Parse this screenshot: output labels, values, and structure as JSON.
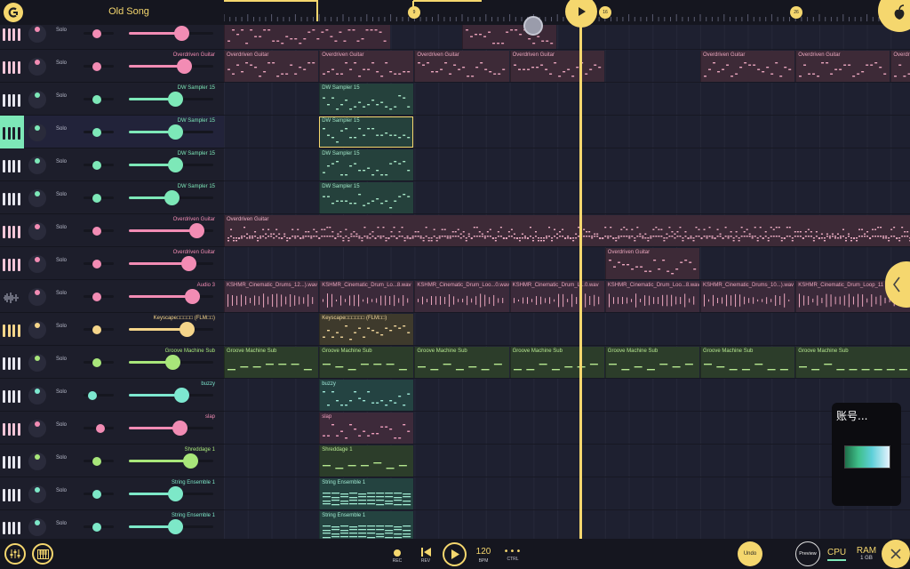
{
  "app": {
    "song_title": "Old Song"
  },
  "timeline": {
    "markers": [
      "9",
      "16",
      "26"
    ]
  },
  "tracks": [
    {
      "name": "",
      "kind": "piano",
      "color": "#f28cb4",
      "vol": 0.62,
      "pan": 0.45,
      "solo_label": "Solo",
      "clip_color": "#3a2a38"
    },
    {
      "name": "Overdriven Guitar",
      "kind": "piano",
      "color": "#f28cb4",
      "vol": 0.65,
      "pan": 0.45,
      "solo_label": "Solo"
    },
    {
      "name": "DW Sampler 15",
      "kind": "piano",
      "color": "#7de8b8",
      "vol": 0.55,
      "pan": 0.45,
      "solo_label": "Solo"
    },
    {
      "name": "DW Sampler 15",
      "kind": "piano",
      "color": "#7de8b8",
      "vol": 0.55,
      "pan": 0.45,
      "solo_label": "Solo",
      "selected": true
    },
    {
      "name": "DW Sampler 15",
      "kind": "piano",
      "color": "#7de8b8",
      "vol": 0.55,
      "pan": 0.45,
      "solo_label": "Solo"
    },
    {
      "name": "DW Sampler 15",
      "kind": "piano",
      "color": "#7de8b8",
      "vol": 0.5,
      "pan": 0.45,
      "solo_label": "Solo"
    },
    {
      "name": "Overdriven Guitar",
      "kind": "piano",
      "color": "#f28cb4",
      "vol": 0.8,
      "pan": 0.45,
      "solo_label": "Solo"
    },
    {
      "name": "Overdriven Guitar",
      "kind": "piano",
      "color": "#f28cb4",
      "vol": 0.7,
      "pan": 0.45,
      "solo_label": "Solo"
    },
    {
      "name": "Audio 3",
      "kind": "audio",
      "color": "#f28cb4",
      "vol": 0.75,
      "pan": 0.45,
      "solo_label": "Solo"
    },
    {
      "name": "Keyscape□□□□□ (FLM□□)",
      "kind": "piano",
      "color": "#f5d58a",
      "vol": 0.68,
      "pan": 0.45,
      "solo_label": "Solo"
    },
    {
      "name": "Groove Machine Sub",
      "kind": "piano",
      "color": "#a8e67a",
      "vol": 0.52,
      "pan": 0.45,
      "solo_label": "Solo"
    },
    {
      "name": "buzzy",
      "kind": "piano",
      "color": "#7de8d0",
      "vol": 0.62,
      "pan": 0.3,
      "solo_label": "Solo"
    },
    {
      "name": "slap",
      "kind": "piano",
      "color": "#f28cb4",
      "vol": 0.6,
      "pan": 0.55,
      "solo_label": "Solo"
    },
    {
      "name": "Shreddage 1",
      "kind": "piano",
      "color": "#a8e67a",
      "vol": 0.73,
      "pan": 0.45,
      "solo_label": "Solo"
    },
    {
      "name": "String Ensemble 1",
      "kind": "piano",
      "color": "#7de8c8",
      "vol": 0.55,
      "pan": 0.45,
      "solo_label": "Solo"
    },
    {
      "name": "String Ensemble 1",
      "kind": "piano",
      "color": "#7de8c8",
      "vol": 0.55,
      "pan": 0.45,
      "solo_label": "Solo"
    }
  ],
  "clips": [
    {
      "lane": 0,
      "start": 0,
      "end": 7,
      "name": "",
      "color": "#3b2836",
      "notes": "#e8a0b8"
    },
    {
      "lane": 0,
      "start": 10,
      "end": 14,
      "name": "",
      "color": "#3b2836",
      "notes": "#e8a0b8"
    },
    {
      "lane": 1,
      "start": 0,
      "end": 4,
      "name": "Overdriven Guitar",
      "color": "#3d2a37",
      "notes": "#e9a5bd",
      "nc": "#e9a5bd"
    },
    {
      "lane": 1,
      "start": 4,
      "end": 8,
      "name": "Overdriven Guitar",
      "color": "#3d2a37",
      "notes": "#e9a5bd",
      "nc": "#e9a5bd"
    },
    {
      "lane": 1,
      "start": 8,
      "end": 12,
      "name": "Overdriven Guitar",
      "color": "#3d2a37",
      "notes": "#e9a5bd",
      "nc": "#e9a5bd"
    },
    {
      "lane": 1,
      "start": 12,
      "end": 16,
      "name": "Overdriven Guitar",
      "color": "#3d2a37",
      "notes": "#e9a5bd",
      "nc": "#e9a5bd"
    },
    {
      "lane": 1,
      "start": 20,
      "end": 24,
      "name": "Overdriven Guitar",
      "color": "#3d2a37",
      "notes": "#e9a5bd",
      "nc": "#e9a5bd"
    },
    {
      "lane": 1,
      "start": 24,
      "end": 28,
      "name": "Overdriven Guitar",
      "color": "#3d2a37",
      "notes": "#e9a5bd",
      "nc": "#e9a5bd"
    },
    {
      "lane": 1,
      "start": 28,
      "end": 30,
      "name": "Overdriven Guitar",
      "color": "#3d2a37",
      "notes": "#e9a5bd",
      "nc": "#e9a5bd"
    },
    {
      "lane": 2,
      "start": 4,
      "end": 8,
      "name": "DW Sampler 15",
      "color": "#25413c",
      "notes": "#a9e8c9",
      "nc": "#9fe3c5"
    },
    {
      "lane": 3,
      "start": 4,
      "end": 8,
      "name": "DW Sampler 15",
      "color": "#25413c",
      "notes": "#a9e8c9",
      "nc": "#9fe3c5",
      "selected": true
    },
    {
      "lane": 4,
      "start": 4,
      "end": 8,
      "name": "DW Sampler 15",
      "color": "#25413c",
      "notes": "#a9e8c9",
      "nc": "#9fe3c5"
    },
    {
      "lane": 5,
      "start": 4,
      "end": 8,
      "name": "DW Sampler 15",
      "color": "#25413c",
      "notes": "#a9e8c9",
      "nc": "#9fe3c5"
    },
    {
      "lane": 6,
      "start": 0,
      "end": 29,
      "name": "Overdriven Guitar",
      "color": "#3d2a37",
      "notes": "#f0b0c6",
      "nc": "#f0b0c6",
      "dense": true
    },
    {
      "lane": 7,
      "start": 16,
      "end": 20,
      "name": "Overdriven Guitar",
      "color": "#3d2a37",
      "notes": "#e9a5bd",
      "nc": "#e9a5bd"
    },
    {
      "lane": 8,
      "start": 0,
      "end": 4,
      "name": "KSHMR_Cinematic_Drums_12...).wav",
      "color": "#3b2a3a",
      "notes": "#e9a5bd",
      "nc": "#e9a5bd",
      "audio": true
    },
    {
      "lane": 8,
      "start": 4,
      "end": 8,
      "name": "KSHMR_Cinematic_Drum_Lo...8.wav",
      "color": "#3b2a3a",
      "notes": "#e9a5bd",
      "nc": "#e9a5bd",
      "audio": true
    },
    {
      "lane": 8,
      "start": 8,
      "end": 12,
      "name": "KSHMR_Cinematic_Drum_Loo...0.wav",
      "color": "#3b2a3a",
      "notes": "#e9a5bd",
      "nc": "#e9a5bd",
      "audio": true
    },
    {
      "lane": 8,
      "start": 12,
      "end": 16,
      "name": "KSHMR_Cinematic_Drum_L...0.wav",
      "color": "#3b2a3a",
      "notes": "#e9a5bd",
      "nc": "#e9a5bd",
      "audio": true
    },
    {
      "lane": 8,
      "start": 16,
      "end": 20,
      "name": "KSHMR_Cinematic_Drum_Loo...8.wav",
      "color": "#3b2a3a",
      "notes": "#e9a5bd",
      "nc": "#e9a5bd",
      "audio": true
    },
    {
      "lane": 8,
      "start": 20,
      "end": 24,
      "name": "KSHMR_Cinematic_Drums_10...).wav",
      "color": "#3b2a3a",
      "notes": "#e9a5bd",
      "nc": "#e9a5bd",
      "audio": true
    },
    {
      "lane": 8,
      "start": 24,
      "end": 29,
      "name": "KSHMR_Cinematic_Drum_Loop_11",
      "color": "#3b2a3a",
      "notes": "#e9a5bd",
      "nc": "#e9a5bd",
      "audio": true
    },
    {
      "lane": 9,
      "start": 4,
      "end": 8,
      "name": "Keyscape□□□□□□ (FLM□□)",
      "color": "#3e3a2c",
      "notes": "#f2d79c",
      "nc": "#f2d79c"
    },
    {
      "lane": 10,
      "start": 0,
      "end": 4,
      "name": "Groove Machine Sub",
      "color": "#2c3d2a",
      "notes": "#b5e68f",
      "nc": "#b5e68f",
      "bass": true
    },
    {
      "lane": 10,
      "start": 4,
      "end": 8,
      "name": "Groove Machine Sub",
      "color": "#2c3d2a",
      "notes": "#b5e68f",
      "nc": "#b5e68f",
      "bass": true
    },
    {
      "lane": 10,
      "start": 8,
      "end": 12,
      "name": "Groove Machine Sub",
      "color": "#2c3d2a",
      "notes": "#b5e68f",
      "nc": "#b5e68f",
      "bass": true
    },
    {
      "lane": 10,
      "start": 12,
      "end": 16,
      "name": "Groove Machine Sub",
      "color": "#2c3d2a",
      "notes": "#b5e68f",
      "nc": "#b5e68f",
      "bass": true
    },
    {
      "lane": 10,
      "start": 16,
      "end": 20,
      "name": "Groove Machine Sub",
      "color": "#2c3d2a",
      "notes": "#b5e68f",
      "nc": "#b5e68f",
      "bass": true
    },
    {
      "lane": 10,
      "start": 20,
      "end": 24,
      "name": "Groove Machine Sub",
      "color": "#2c3d2a",
      "notes": "#b5e68f",
      "nc": "#b5e68f",
      "bass": true
    },
    {
      "lane": 10,
      "start": 24,
      "end": 29,
      "name": "Groove Machine Sub",
      "color": "#2c3d2a",
      "notes": "#b5e68f",
      "nc": "#b5e68f",
      "bass": true
    },
    {
      "lane": 11,
      "start": 4,
      "end": 8,
      "name": "buzzy",
      "color": "#244342",
      "notes": "#9fe8d8",
      "nc": "#9fe8d8"
    },
    {
      "lane": 12,
      "start": 4,
      "end": 8,
      "name": "slap",
      "color": "#3d2a3a",
      "notes": "#ee9fbd",
      "nc": "#ee9fbd"
    },
    {
      "lane": 13,
      "start": 4,
      "end": 8,
      "name": "Shreddage 1",
      "color": "#2c3d2a",
      "notes": "#b5e68f",
      "nc": "#b5e68f",
      "bass": true
    },
    {
      "lane": 14,
      "start": 4,
      "end": 8,
      "name": "String Ensemble 1",
      "color": "#244340",
      "notes": "#9fe8d0",
      "nc": "#9fe8d0",
      "strings": true
    },
    {
      "lane": 15,
      "start": 4,
      "end": 8,
      "name": "String Ensemble 1",
      "color": "#244340",
      "notes": "#9fe8d0",
      "nc": "#9fe8d0",
      "strings": true
    }
  ],
  "popup": {
    "title": "账号..."
  },
  "bottom": {
    "rec_label": "REC",
    "rev_label": "REV",
    "bpm_value": "120",
    "bpm_label": "BPM",
    "ctrl_label": "CTRL",
    "undo_label": "Undo",
    "preview_label": "Preview",
    "cpu_label": "CPU",
    "ram_label": "RAM",
    "ram_value": "1 GB"
  },
  "colors": {
    "accent": "#f5d76e",
    "pink": "#f28cb4",
    "mint": "#7de8b8",
    "lime": "#a8e67a"
  }
}
